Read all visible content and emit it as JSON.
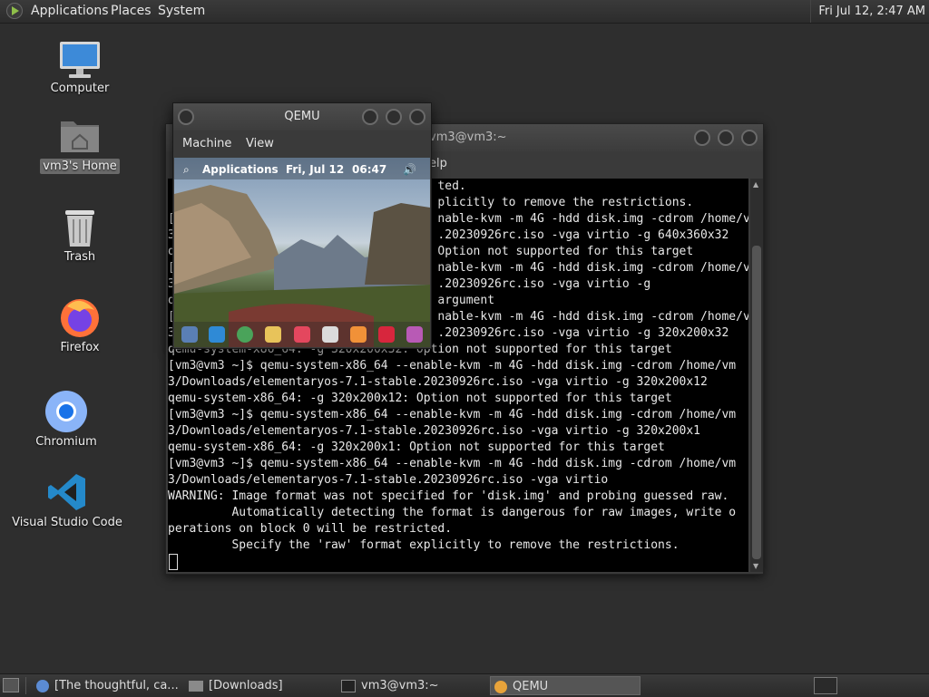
{
  "top_panel": {
    "menus": [
      "Applications",
      "Places",
      "System"
    ],
    "clock": "Fri Jul 12,  2:47 AM"
  },
  "desktop_icons": [
    {
      "label": "Computer",
      "icon": "computer-icon"
    },
    {
      "label": "vm3's Home",
      "icon": "home-folder-icon"
    },
    {
      "label": "Trash",
      "icon": "trash-icon"
    },
    {
      "label": "Firefox",
      "icon": "firefox-icon"
    },
    {
      "label": "Chromium",
      "icon": "chromium-icon"
    },
    {
      "label": "Visual Studio Code",
      "icon": "vscode-icon"
    }
  ],
  "terminal": {
    "title": "vm3@vm3:~",
    "menus": [
      "elp"
    ],
    "lines": [
      "\t\t\t\t\t\t\t\t\t\t\t\t\t\t\t\t\t\t\t\t\t\t\t\t\t\t\t\t\t\t\t\t\tted.",
      "\t\t\t\t\t\t\t\t\t\t\t\t\t\t\t\t\t\t\t\t\t\t\t\t\t\t\t\t\t\t\t\t\tplicitly to remove the restrictions.",
      "[\t\t\t\t\t\t\t\t\t\t\t\t\t\t\t\t\t\t\t\t\t\t\t\t\t\t\t\t\t\t\t\tnable-kvm -m 4G -hdd disk.img -cdrom /home/vm",
      "3\t\t\t\t\t\t\t\t\t\t\t\t\t\t\t\t\t\t\t\t\t\t\t\t\t\t\t\t\t\t\t\t.20230926rc.iso -vga virtio -g 640x360x32",
      "q\t\t\t\t\t\t\t\t\t\t\t\t\t\t\t\t\t\t\t\t\t\t\t\t\t\t\t\t\t\t\t\tOption not supported for this target",
      "[\t\t\t\t\t\t\t\t\t\t\t\t\t\t\t\t\t\t\t\t\t\t\t\t\t\t\t\t\t\t\t\tnable-kvm -m 4G -hdd disk.img -cdrom /home/vm",
      "3\t\t\t\t\t\t\t\t\t\t\t\t\t\t\t\t\t\t\t\t\t\t\t\t\t\t\t\t\t\t\t\t.20230926rc.iso -vga virtio -g",
      "q\t\t\t\t\t\t\t\t\t\t\t\t\t\t\t\t\t\t\t\t\t\t\t\t\t\t\t\t\t\t\t\targument",
      "[\t\t\t\t\t\t\t\t\t\t\t\t\t\t\t\t\t\t\t\t\t\t\t\t\t\t\t\t\t\t\t\tnable-kvm -m 4G -hdd disk.img -cdrom /home/vm",
      "3\t\t\t\t\t\t\t\t\t\t\t\t\t\t\t\t\t\t\t\t\t\t\t\t\t\t\t\t\t\t\t\t.20230926rc.iso -vga virtio -g 320x200x32",
      "qemu-system-x86_64: -g 320x200x32: Option not supported for this target",
      "[vm3@vm3 ~]$ qemu-system-x86_64 --enable-kvm -m 4G -hdd disk.img -cdrom /home/vm",
      "3/Downloads/elementaryos-7.1-stable.20230926rc.iso -vga virtio -g 320x200x12",
      "qemu-system-x86_64: -g 320x200x12: Option not supported for this target",
      "[vm3@vm3 ~]$ qemu-system-x86_64 --enable-kvm -m 4G -hdd disk.img -cdrom /home/vm",
      "3/Downloads/elementaryos-7.1-stable.20230926rc.iso -vga virtio -g 320x200x1",
      "qemu-system-x86_64: -g 320x200x1: Option not supported for this target",
      "[vm3@vm3 ~]$ qemu-system-x86_64 --enable-kvm -m 4G -hdd disk.img -cdrom /home/vm",
      "3/Downloads/elementaryos-7.1-stable.20230926rc.iso -vga virtio",
      "WARNING: Image format was not specified for 'disk.img' and probing guessed raw.",
      "         Automatically detecting the format is dangerous for raw images, write o",
      "perations on block 0 will be restricted.",
      "         Specify the 'raw' format explicitly to remove the restrictions."
    ]
  },
  "qemu": {
    "title": "QEMU",
    "menus": [
      "Machine",
      "View"
    ],
    "guest_bar": {
      "left": "Applications",
      "date": "Fri, Jul 12",
      "time": "06:47"
    }
  },
  "taskbar": {
    "tasks": [
      {
        "label": "[The thoughtful, ca..."
      },
      {
        "label": "[Downloads]"
      },
      {
        "label": "vm3@vm3:~"
      },
      {
        "label": "QEMU",
        "active": true
      }
    ]
  }
}
